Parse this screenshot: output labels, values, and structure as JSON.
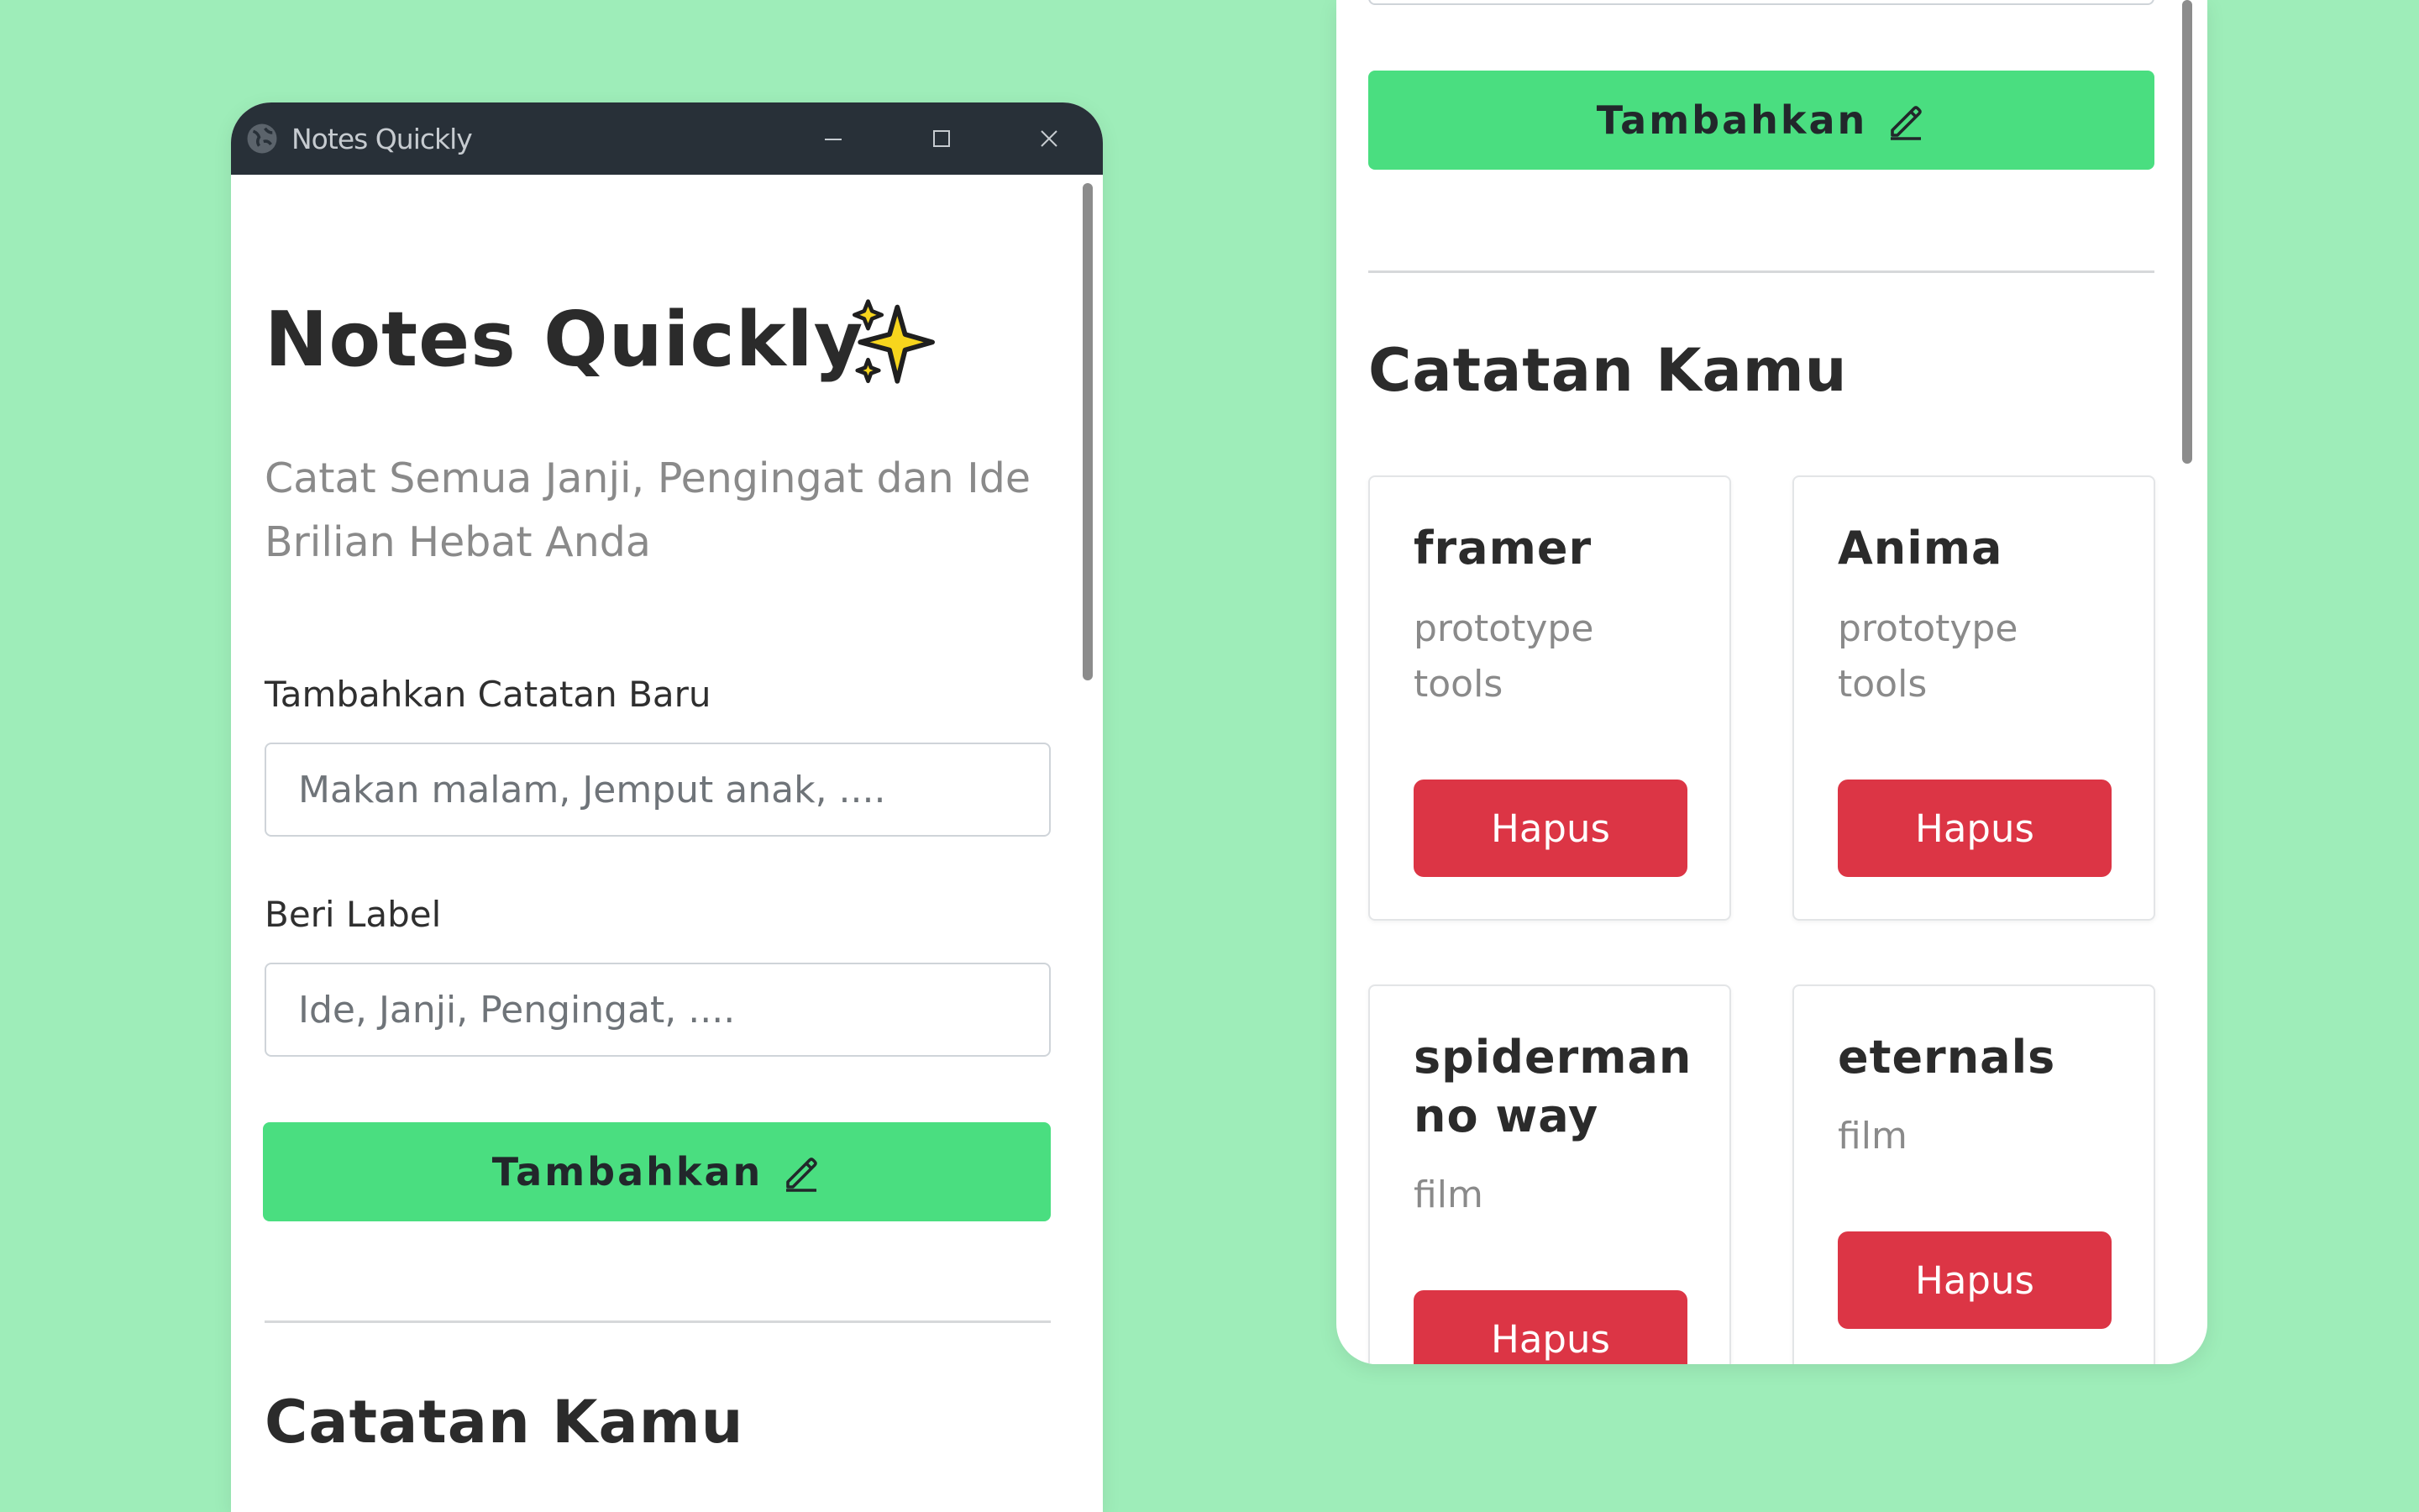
{
  "window": {
    "title": "Notes Quickly"
  },
  "app": {
    "title": "Notes Quickly",
    "title_emoji": "sparkles-icon",
    "subtitle": "Catat Semua Janji, Pengingat dan Ide Brilian Hebat Anda"
  },
  "form": {
    "note_label": "Tambahkan Catatan Baru",
    "note_placeholder": "Makan malam, Jemput anak, ....",
    "tag_label": "Beri Label",
    "tag_placeholder": "Ide, Janji, Pengingat, ....",
    "submit_label": "Tambahkan",
    "submit_icon": "pencil-icon"
  },
  "notes_section": {
    "title": "Catatan Kamu"
  },
  "notes": [
    {
      "title": "framer",
      "label": "prototype tools",
      "delete_label": "Hapus"
    },
    {
      "title": "Anima",
      "label": "prototype tools",
      "delete_label": "Hapus"
    },
    {
      "title": "spiderman no way",
      "label": "film",
      "delete_label": "Hapus"
    },
    {
      "title": "eternals",
      "label": "film",
      "delete_label": "Hapus"
    }
  ],
  "colors": {
    "background": "#9eedb9",
    "titlebar": "#283038",
    "accent_green": "#4ade80",
    "danger_red": "#dc3545",
    "sparkle_yellow": "#f7d51d"
  }
}
